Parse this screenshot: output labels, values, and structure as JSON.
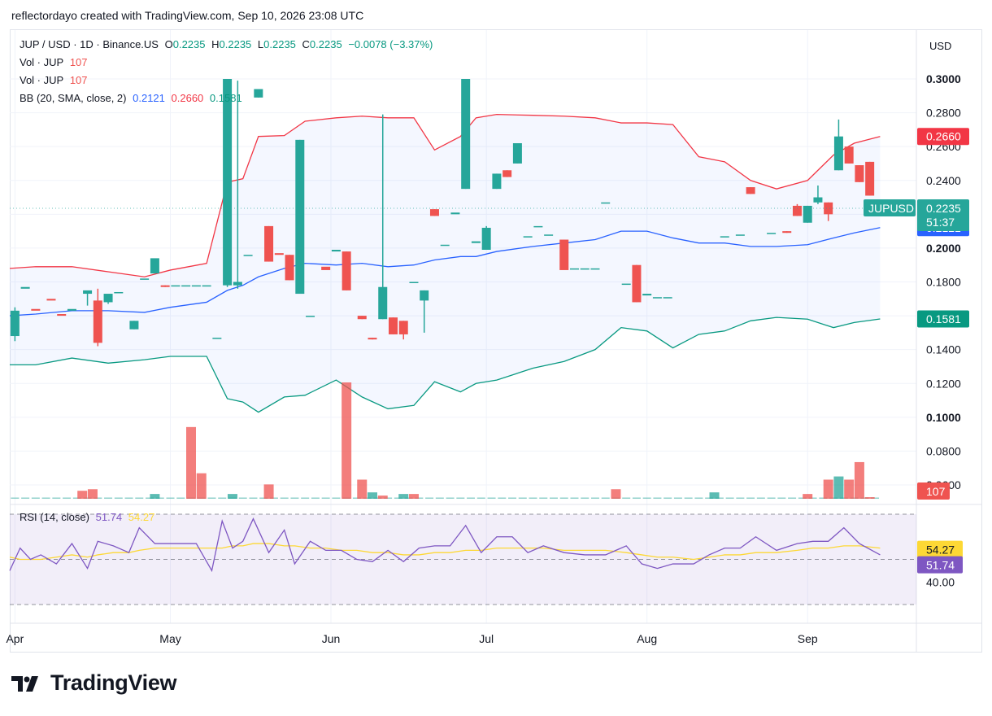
{
  "header": {
    "text": "reflectordayo created with TradingView.com, Sep 10, 2026 23:08 UTC"
  },
  "legend": {
    "symbol": "JUP / USD · 1D · Binance.US",
    "o_label": "O",
    "o_value": "0.2235",
    "h_label": "H",
    "h_value": "0.2235",
    "l_label": "L",
    "l_value": "0.2235",
    "c_label": "C",
    "c_value": "0.2235",
    "change": "−0.0078 (−3.37%)",
    "vol1_label": "Vol · JUP",
    "vol1_value": "107",
    "vol2_label": "Vol · JUP",
    "vol2_value": "107",
    "bb_label": "BB (20, SMA, close, 2)",
    "bb_basis": "0.2121",
    "bb_upper": "0.2660",
    "bb_lower": "0.1581"
  },
  "rsi_legend": {
    "label": "RSI (14, close)",
    "rsi": "51.74",
    "ma": "54.27"
  },
  "price_axis": {
    "currency": "USD",
    "ticks": [
      "0.3000",
      "0.2800",
      "0.2600",
      "0.2400",
      "0.2200",
      "0.2000",
      "0.1800",
      "0.1600",
      "0.1400",
      "0.1200",
      "0.1000",
      "0.0800",
      "0.0600"
    ],
    "tags": {
      "upper": "0.2660",
      "price": "0.2235",
      "countdown": "51:37",
      "symbol": "JUPUSD",
      "basis": "0.2121",
      "lower": "0.1581",
      "volume": "107"
    }
  },
  "rsi_axis": {
    "tick": "40.00",
    "ma_tag": "54.27",
    "rsi_tag": "51.74"
  },
  "time_axis": {
    "labels": [
      "Apr",
      "May",
      "Jun",
      "Jul",
      "Aug",
      "Sep"
    ]
  },
  "colors": {
    "up": "#26a69a",
    "down": "#ef5350",
    "upper": "#f23645",
    "basis": "#2962ff",
    "lower": "#089981",
    "rsi": "#7e57c2",
    "rsi_ma": "#fdd835",
    "bb_fill": "#2962ff"
  },
  "footer": {
    "brand": "TradingView",
    "logo": "tradingview-logo-icon"
  },
  "chart_data": {
    "type": "candlestick",
    "title": "JUP / USD · 1D · Binance.US",
    "ylim": [
      0.06,
      0.3
    ],
    "grid": true,
    "x_range": [
      "2026-03-31",
      "2026-09-22"
    ],
    "month_ticks": [
      {
        "label": "Apr",
        "date": "2026-04-01"
      },
      {
        "label": "May",
        "date": "2026-05-01"
      },
      {
        "label": "Jun",
        "date": "2026-06-01"
      },
      {
        "label": "Jul",
        "date": "2026-07-01"
      },
      {
        "label": "Aug",
        "date": "2026-08-01"
      },
      {
        "label": "Sep",
        "date": "2026-09-01"
      }
    ],
    "candles": [
      {
        "d": "2026-04-01",
        "o": 0.148,
        "h": 0.165,
        "l": 0.145,
        "c": 0.163
      },
      {
        "d": "2026-04-03",
        "o": 0.176,
        "h": 0.176,
        "l": 0.176,
        "c": 0.177
      },
      {
        "d": "2026-04-05",
        "o": 0.164,
        "h": 0.164,
        "l": 0.164,
        "c": 0.163
      },
      {
        "d": "2026-04-08",
        "o": 0.17,
        "h": 0.17,
        "l": 0.17,
        "c": 0.169
      },
      {
        "d": "2026-04-10",
        "o": 0.161,
        "h": 0.161,
        "l": 0.161,
        "c": 0.16
      },
      {
        "d": "2026-04-12",
        "o": 0.163,
        "h": 0.163,
        "l": 0.163,
        "c": 0.164
      },
      {
        "d": "2026-04-15",
        "o": 0.173,
        "h": 0.174,
        "l": 0.166,
        "c": 0.175
      },
      {
        "d": "2026-04-17",
        "o": 0.169,
        "h": 0.176,
        "l": 0.142,
        "c": 0.144
      },
      {
        "d": "2026-04-19",
        "o": 0.168,
        "h": 0.168,
        "l": 0.167,
        "c": 0.173
      },
      {
        "d": "2026-04-21",
        "o": 0.174,
        "h": 0.174,
        "l": 0.174,
        "c": 0.174
      },
      {
        "d": "2026-04-24",
        "o": 0.152,
        "h": 0.157,
        "l": 0.152,
        "c": 0.157
      },
      {
        "d": "2026-04-26",
        "o": 0.182,
        "h": 0.182,
        "l": 0.182,
        "c": 0.182
      },
      {
        "d": "2026-04-28",
        "o": 0.185,
        "h": 0.186,
        "l": 0.185,
        "c": 0.194
      },
      {
        "d": "2026-04-30",
        "o": 0.178,
        "h": 0.178,
        "l": 0.177,
        "c": 0.177
      },
      {
        "d": "2026-05-02",
        "o": 0.178,
        "h": 0.178,
        "l": 0.178,
        "c": 0.178
      },
      {
        "d": "2026-05-04",
        "o": 0.178,
        "h": 0.178,
        "l": 0.178,
        "c": 0.178
      },
      {
        "d": "2026-05-06",
        "o": 0.178,
        "h": 0.178,
        "l": 0.178,
        "c": 0.178
      },
      {
        "d": "2026-05-08",
        "o": 0.178,
        "h": 0.178,
        "l": 0.178,
        "c": 0.178
      },
      {
        "d": "2026-05-10",
        "o": 0.147,
        "h": 0.147,
        "l": 0.147,
        "c": 0.147
      },
      {
        "d": "2026-05-12",
        "o": 0.178,
        "h": 0.3,
        "l": 0.177,
        "c": 0.3
      },
      {
        "d": "2026-05-14",
        "o": 0.178,
        "h": 0.299,
        "l": 0.176,
        "c": 0.18
      },
      {
        "d": "2026-05-16",
        "o": 0.196,
        "h": 0.196,
        "l": 0.196,
        "c": 0.196
      },
      {
        "d": "2026-05-18",
        "o": 0.289,
        "h": 0.291,
        "l": 0.289,
        "c": 0.294
      },
      {
        "d": "2026-05-20",
        "o": 0.213,
        "h": 0.213,
        "l": 0.192,
        "c": 0.192
      },
      {
        "d": "2026-05-22",
        "o": 0.197,
        "h": 0.197,
        "l": 0.197,
        "c": 0.196
      },
      {
        "d": "2026-05-24",
        "o": 0.196,
        "h": 0.196,
        "l": 0.181,
        "c": 0.181
      },
      {
        "d": "2026-05-26",
        "o": 0.173,
        "h": 0.264,
        "l": 0.173,
        "c": 0.264
      },
      {
        "d": "2026-05-28",
        "o": 0.16,
        "h": 0.16,
        "l": 0.16,
        "c": 0.16
      },
      {
        "d": "2026-05-31",
        "o": 0.189,
        "h": 0.189,
        "l": 0.189,
        "c": 0.187
      },
      {
        "d": "2026-06-02",
        "o": 0.198,
        "h": 0.198,
        "l": 0.198,
        "c": 0.199
      },
      {
        "d": "2026-06-04",
        "o": 0.198,
        "h": 0.198,
        "l": 0.175,
        "c": 0.175
      },
      {
        "d": "2026-06-07",
        "o": 0.16,
        "h": 0.16,
        "l": 0.158,
        "c": 0.158
      },
      {
        "d": "2026-06-09",
        "o": 0.147,
        "h": 0.147,
        "l": 0.146,
        "c": 0.146
      },
      {
        "d": "2026-06-11",
        "o": 0.158,
        "h": 0.279,
        "l": 0.158,
        "c": 0.177
      },
      {
        "d": "2026-06-13",
        "o": 0.159,
        "h": 0.159,
        "l": 0.149,
        "c": 0.149
      },
      {
        "d": "2026-06-15",
        "o": 0.157,
        "h": 0.157,
        "l": 0.146,
        "c": 0.149
      },
      {
        "d": "2026-06-17",
        "o": 0.18,
        "h": 0.18,
        "l": 0.18,
        "c": 0.18
      },
      {
        "d": "2026-06-19",
        "o": 0.169,
        "h": 0.175,
        "l": 0.15,
        "c": 0.175
      },
      {
        "d": "2026-06-21",
        "o": 0.223,
        "h": 0.223,
        "l": 0.219,
        "c": 0.219
      },
      {
        "d": "2026-06-23",
        "o": 0.202,
        "h": 0.202,
        "l": 0.202,
        "c": 0.202
      },
      {
        "d": "2026-06-25",
        "o": 0.22,
        "h": 0.22,
        "l": 0.22,
        "c": 0.221
      },
      {
        "d": "2026-06-27",
        "o": 0.235,
        "h": 0.3,
        "l": 0.235,
        "c": 0.3
      },
      {
        "d": "2026-06-29",
        "o": 0.203,
        "h": 0.203,
        "l": 0.203,
        "c": 0.204
      },
      {
        "d": "2026-07-01",
        "o": 0.199,
        "h": 0.213,
        "l": 0.199,
        "c": 0.212
      },
      {
        "d": "2026-07-03",
        "o": 0.235,
        "h": 0.244,
        "l": 0.235,
        "c": 0.244
      },
      {
        "d": "2026-07-05",
        "o": 0.246,
        "h": 0.246,
        "l": 0.242,
        "c": 0.242
      },
      {
        "d": "2026-07-07",
        "o": 0.25,
        "h": 0.262,
        "l": 0.25,
        "c": 0.262
      },
      {
        "d": "2026-07-09",
        "o": 0.207,
        "h": 0.207,
        "l": 0.207,
        "c": 0.207
      },
      {
        "d": "2026-07-11",
        "o": 0.213,
        "h": 0.213,
        "l": 0.213,
        "c": 0.213
      },
      {
        "d": "2026-07-13",
        "o": 0.208,
        "h": 0.208,
        "l": 0.208,
        "c": 0.208
      },
      {
        "d": "2026-07-16",
        "o": 0.205,
        "h": 0.205,
        "l": 0.188,
        "c": 0.187
      },
      {
        "d": "2026-07-18",
        "o": 0.188,
        "h": 0.188,
        "l": 0.188,
        "c": 0.188
      },
      {
        "d": "2026-07-20",
        "o": 0.188,
        "h": 0.188,
        "l": 0.188,
        "c": 0.188
      },
      {
        "d": "2026-07-22",
        "o": 0.188,
        "h": 0.188,
        "l": 0.188,
        "c": 0.188
      },
      {
        "d": "2026-07-24",
        "o": 0.227,
        "h": 0.227,
        "l": 0.227,
        "c": 0.227
      },
      {
        "d": "2026-07-28",
        "o": 0.179,
        "h": 0.179,
        "l": 0.179,
        "c": 0.179
      },
      {
        "d": "2026-07-30",
        "o": 0.19,
        "h": 0.19,
        "l": 0.168,
        "c": 0.168
      },
      {
        "d": "2026-08-01",
        "o": 0.172,
        "h": 0.172,
        "l": 0.172,
        "c": 0.173
      },
      {
        "d": "2026-08-03",
        "o": 0.171,
        "h": 0.171,
        "l": 0.171,
        "c": 0.171
      },
      {
        "d": "2026-08-05",
        "o": 0.171,
        "h": 0.171,
        "l": 0.171,
        "c": 0.171
      },
      {
        "d": "2026-08-16",
        "o": 0.207,
        "h": 0.207,
        "l": 0.207,
        "c": 0.207
      },
      {
        "d": "2026-08-19",
        "o": 0.208,
        "h": 0.208,
        "l": 0.208,
        "c": 0.208
      },
      {
        "d": "2026-08-21",
        "o": 0.236,
        "h": 0.236,
        "l": 0.232,
        "c": 0.232
      },
      {
        "d": "2026-08-25",
        "o": 0.209,
        "h": 0.209,
        "l": 0.209,
        "c": 0.209
      },
      {
        "d": "2026-08-28",
        "o": 0.21,
        "h": 0.21,
        "l": 0.209,
        "c": 0.209
      },
      {
        "d": "2026-08-30",
        "o": 0.225,
        "h": 0.226,
        "l": 0.219,
        "c": 0.219
      },
      {
        "d": "2026-09-01",
        "o": 0.215,
        "h": 0.225,
        "l": 0.215,
        "c": 0.225
      },
      {
        "d": "2026-09-03",
        "o": 0.227,
        "h": 0.237,
        "l": 0.226,
        "c": 0.23
      },
      {
        "d": "2026-09-05",
        "o": 0.227,
        "h": 0.227,
        "l": 0.216,
        "c": 0.22
      },
      {
        "d": "2026-09-07",
        "o": 0.246,
        "h": 0.276,
        "l": 0.246,
        "c": 0.266
      },
      {
        "d": "2026-09-09",
        "o": 0.26,
        "h": 0.26,
        "l": 0.25,
        "c": 0.25
      },
      {
        "d": "2026-09-11",
        "o": 0.249,
        "h": 0.249,
        "l": 0.239,
        "c": 0.239
      },
      {
        "d": "2026-09-13",
        "o": 0.251,
        "h": 0.251,
        "l": 0.231,
        "c": 0.231
      },
      {
        "d": "2026-09-15",
        "o": 0.2235,
        "h": 0.2235,
        "l": 0.2235,
        "c": 0.2235
      }
    ],
    "bollinger": {
      "dates": [
        "2026-03-31",
        "2026-04-05",
        "2026-04-12",
        "2026-04-19",
        "2026-04-26",
        "2026-05-01",
        "2026-05-08",
        "2026-05-12",
        "2026-05-15",
        "2026-05-18",
        "2026-05-23",
        "2026-05-27",
        "2026-06-02",
        "2026-06-07",
        "2026-06-12",
        "2026-06-17",
        "2026-06-21",
        "2026-06-26",
        "2026-06-29",
        "2026-07-03",
        "2026-07-10",
        "2026-07-16",
        "2026-07-22",
        "2026-07-27",
        "2026-08-01",
        "2026-08-06",
        "2026-08-11",
        "2026-08-16",
        "2026-08-21",
        "2026-08-26",
        "2026-09-01",
        "2026-09-06",
        "2026-09-10",
        "2026-09-15"
      ],
      "upper": [
        0.188,
        0.189,
        0.189,
        0.186,
        0.183,
        0.187,
        0.191,
        0.239,
        0.241,
        0.266,
        0.2665,
        0.275,
        0.277,
        0.278,
        0.277,
        0.277,
        0.258,
        0.266,
        0.277,
        0.279,
        0.2785,
        0.278,
        0.277,
        0.274,
        0.274,
        0.273,
        0.254,
        0.251,
        0.24,
        0.235,
        0.24,
        0.255,
        0.262,
        0.266
      ],
      "basis": [
        0.16,
        0.161,
        0.163,
        0.163,
        0.162,
        0.165,
        0.168,
        0.175,
        0.178,
        0.183,
        0.188,
        0.191,
        0.19,
        0.191,
        0.189,
        0.19,
        0.193,
        0.195,
        0.195,
        0.198,
        0.201,
        0.203,
        0.205,
        0.21,
        0.21,
        0.206,
        0.203,
        0.203,
        0.201,
        0.201,
        0.202,
        0.206,
        0.209,
        0.2121
      ],
      "lower": [
        0.131,
        0.131,
        0.135,
        0.132,
        0.134,
        0.136,
        0.136,
        0.111,
        0.109,
        0.103,
        0.112,
        0.113,
        0.122,
        0.112,
        0.105,
        0.107,
        0.121,
        0.115,
        0.12,
        0.122,
        0.129,
        0.133,
        0.14,
        0.153,
        0.151,
        0.141,
        0.149,
        0.151,
        0.157,
        0.159,
        0.158,
        0.153,
        0.156,
        0.1581
      ]
    },
    "volume": {
      "unit_label": "Vol · JUP",
      "bars": [
        {
          "d": "2026-04-14",
          "v": 5,
          "up": false
        },
        {
          "d": "2026-04-16",
          "v": 6,
          "up": false
        },
        {
          "d": "2026-04-28",
          "v": 3,
          "up": true
        },
        {
          "d": "2026-05-05",
          "v": 45,
          "up": false
        },
        {
          "d": "2026-05-07",
          "v": 16,
          "up": false
        },
        {
          "d": "2026-05-13",
          "v": 3,
          "up": true
        },
        {
          "d": "2026-05-20",
          "v": 9,
          "up": false
        },
        {
          "d": "2026-06-04",
          "v": 73,
          "up": false
        },
        {
          "d": "2026-06-07",
          "v": 12,
          "up": false
        },
        {
          "d": "2026-06-09",
          "v": 4,
          "up": true
        },
        {
          "d": "2026-06-11",
          "v": 2,
          "up": false
        },
        {
          "d": "2026-06-15",
          "v": 3,
          "up": true
        },
        {
          "d": "2026-06-17",
          "v": 3,
          "up": false
        },
        {
          "d": "2026-07-26",
          "v": 6,
          "up": false
        },
        {
          "d": "2026-08-14",
          "v": 4,
          "up": true
        },
        {
          "d": "2026-09-01",
          "v": 3,
          "up": false
        },
        {
          "d": "2026-09-05",
          "v": 12,
          "up": false
        },
        {
          "d": "2026-09-07",
          "v": 14,
          "up": true
        },
        {
          "d": "2026-09-09",
          "v": 12,
          "up": false
        },
        {
          "d": "2026-09-11",
          "v": 23,
          "up": false
        },
        {
          "d": "2026-09-13",
          "v": 1,
          "up": false
        }
      ]
    },
    "rsi": {
      "label": "RSI (14, close)",
      "bands": [
        30,
        50,
        70
      ],
      "dates": [
        "2026-03-31",
        "2026-04-02",
        "2026-04-04",
        "2026-04-06",
        "2026-04-09",
        "2026-04-12",
        "2026-04-15",
        "2026-04-17",
        "2026-04-20",
        "2026-04-23",
        "2026-04-25",
        "2026-04-28",
        "2026-05-02",
        "2026-05-06",
        "2026-05-09",
        "2026-05-11",
        "2026-05-13",
        "2026-05-15",
        "2026-05-17",
        "2026-05-20",
        "2026-05-23",
        "2026-05-25",
        "2026-05-28",
        "2026-05-31",
        "2026-06-03",
        "2026-06-06",
        "2026-06-09",
        "2026-06-12",
        "2026-06-15",
        "2026-06-18",
        "2026-06-21",
        "2026-06-24",
        "2026-06-27",
        "2026-06-30",
        "2026-07-03",
        "2026-07-06",
        "2026-07-09",
        "2026-07-12",
        "2026-07-16",
        "2026-07-20",
        "2026-07-24",
        "2026-07-28",
        "2026-07-31",
        "2026-08-03",
        "2026-08-06",
        "2026-08-10",
        "2026-08-13",
        "2026-08-16",
        "2026-08-19",
        "2026-08-22",
        "2026-08-26",
        "2026-08-30",
        "2026-09-02",
        "2026-09-05",
        "2026-09-08",
        "2026-09-11",
        "2026-09-15"
      ],
      "values": [
        45,
        55,
        50,
        52,
        48,
        57,
        46,
        58,
        56,
        53,
        64,
        57,
        57,
        57,
        45,
        67,
        55,
        58,
        68,
        53,
        63,
        48,
        58,
        54,
        54,
        50,
        49,
        54,
        49,
        55,
        56,
        56,
        65,
        53,
        60,
        60,
        53,
        56,
        53,
        52,
        52,
        56,
        48,
        46,
        48,
        48,
        52,
        55,
        55,
        60,
        54,
        57,
        58,
        58,
        64,
        57,
        52
      ],
      "ma": [
        51,
        50,
        50,
        50,
        51,
        52,
        51,
        52,
        53,
        53,
        54,
        55,
        55,
        55,
        55,
        55,
        56,
        56,
        57,
        57,
        56,
        56,
        55,
        55,
        54,
        54,
        53,
        53,
        52,
        52,
        53,
        53,
        54,
        54,
        55,
        55,
        55,
        55,
        54,
        54,
        54,
        53,
        52,
        51,
        51,
        50,
        51,
        52,
        52,
        53,
        53,
        54,
        55,
        55,
        56,
        56,
        55
      ]
    }
  }
}
